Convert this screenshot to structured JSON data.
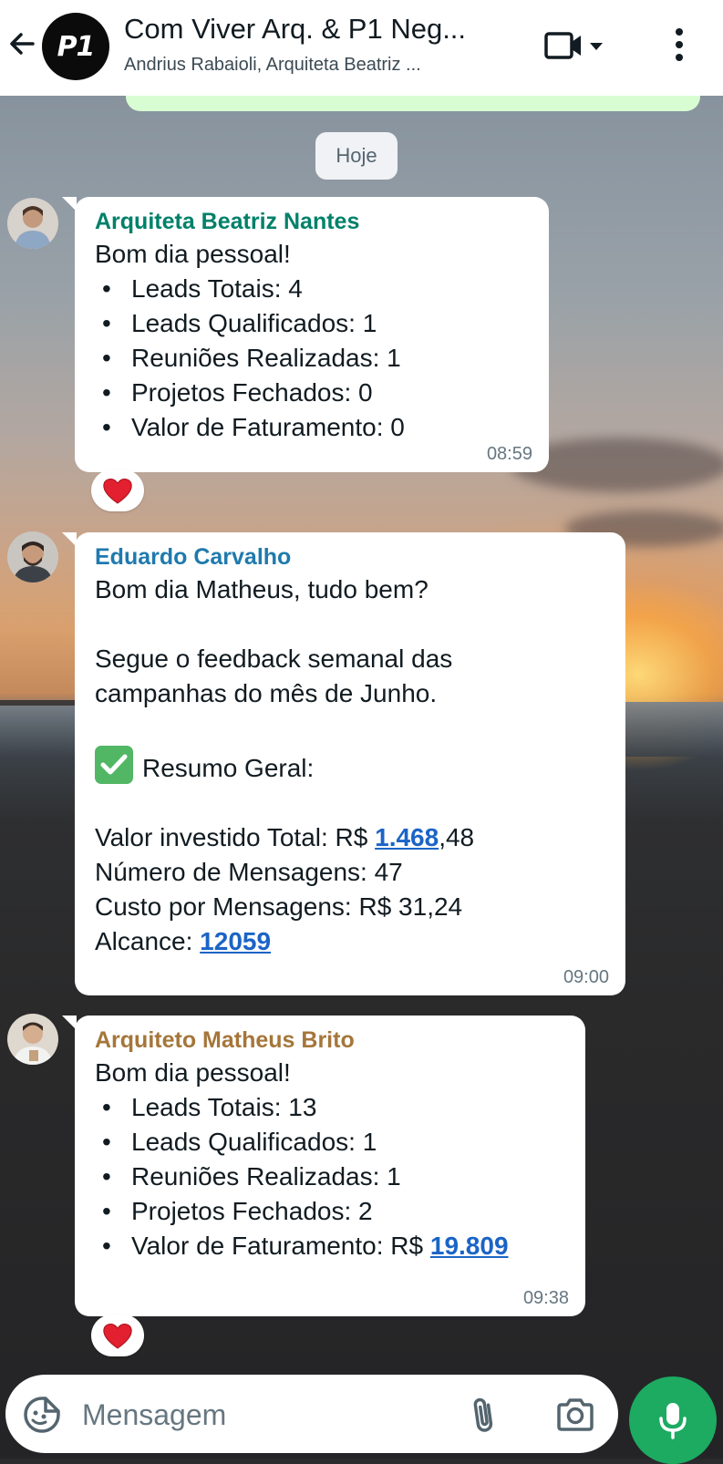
{
  "header": {
    "title": "Com Viver Arq. & P1 Neg...",
    "subtitle": "Andrius Rabaioli, Arquiteta Beatriz ...",
    "group_avatar_text": "P1",
    "icons": [
      "back-arrow-icon",
      "video-call-icon",
      "dropdown-caret-icon",
      "more-vert-icon"
    ]
  },
  "date_divider": "Hoje",
  "messages": [
    {
      "sender": "Arquiteta Beatriz Nantes",
      "sender_color": "#008069",
      "intro": "Bom dia pessoal!",
      "bullets": [
        "Leads Totais: 4",
        "Leads Qualificados: 1",
        "Reuniões Realizadas: 1",
        "Projetos Fechados: 0",
        "Valor de Faturamento: 0"
      ],
      "time": "08:59",
      "reaction": "❤️"
    },
    {
      "sender": "Eduardo Carvalho",
      "sender_color": "#1f7aad",
      "greeting": "Bom dia Matheus, tudo bem?",
      "para_line1": "Segue o feedback semanal das",
      "para_line2": "campanhas do mês de Junho.",
      "summary_label": "Resumo Geral:",
      "invest_prefix": "Valor investido Total: R$ ",
      "invest_link": "1.468",
      "invest_suffix": ",48",
      "messages_count": "Número de Mensagens: 47",
      "cost_per_message": "Custo por Mensagens: R$ 31,24",
      "reach_prefix": "Alcance: ",
      "reach_link": "12059",
      "time": "09:00"
    },
    {
      "sender": "Arquiteto Matheus Brito",
      "sender_color": "#a5763a",
      "intro": "Bom dia pessoal!",
      "bullets": [
        "Leads Totais: 13",
        "Leads Qualificados: 1",
        "Reuniões Realizadas: 1",
        "Projetos Fechados: 2"
      ],
      "revenue_prefix": "Valor de Faturamento: R$ ",
      "revenue_link": "19.809",
      "time": "09:38",
      "reaction": "❤️"
    }
  ],
  "composer": {
    "placeholder": "Mensagem",
    "icons": [
      "emoji-sticker-icon",
      "paperclip-icon",
      "camera-icon",
      "microphone-icon"
    ]
  },
  "colors": {
    "accent_green": "#1daa61",
    "link_blue": "#1b64c6",
    "outgoing_bubble": "#d9fdd3"
  }
}
